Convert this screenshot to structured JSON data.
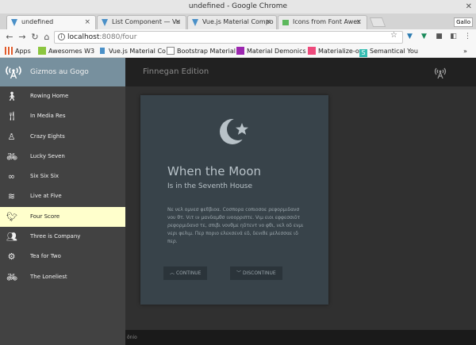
{
  "window": {
    "title": "undefined - Google Chrome"
  },
  "tabs": [
    {
      "label": "undefined",
      "active": true
    },
    {
      "label": "List Component — Vu"
    },
    {
      "label": "Vue.js Material Compo"
    },
    {
      "label": "Icons from Font Awes"
    }
  ],
  "profile_label": "Gallo",
  "address": {
    "host": "localhost",
    "path": ":8080/four"
  },
  "bookmarks": [
    {
      "label": "Apps"
    },
    {
      "label": "Awesomes W3"
    },
    {
      "label": "Vue.js Material Co"
    },
    {
      "label": "Bootstrap Material"
    },
    {
      "label": "Material Demonics"
    },
    {
      "label": "Materialize-o"
    },
    {
      "label": "Semantical You"
    }
  ],
  "app": {
    "brand": "Gizmos au Gogo",
    "toolbar_title": "Finnegan Edition",
    "nav_items": [
      {
        "label": "Rowing Home",
        "icon": "walking-icon"
      },
      {
        "label": "In Media Res",
        "icon": "utensils-icon"
      },
      {
        "label": "Crazy Eights",
        "icon": "meditation-icon"
      },
      {
        "label": "Lucky Seven",
        "icon": "bicycle-icon"
      },
      {
        "label": "Six Six Six",
        "icon": "infinity-icon"
      },
      {
        "label": "Live at Five",
        "icon": "waves-icon"
      },
      {
        "label": "Four Score",
        "icon": "bird-icon",
        "active": true
      },
      {
        "label": "Three is Company",
        "icon": "users-icon"
      },
      {
        "label": "Tea for Two",
        "icon": "gear-icon"
      },
      {
        "label": "The Loneliest",
        "icon": "bicycle-icon"
      }
    ],
    "card": {
      "title": "When the Moon",
      "subtitle": "Is in the Seventh House",
      "body": "Νε νελ ομνεσ φεϐβιοα. Cοσπορα coπιοσοε ρεφορμιδανσ νου θτ. Vιτ ιν μανδαμθσ ινοορριπτε. Vιμ ειοι εφφεσσιδτ ρεφορμιδανσ τε, σπιβι νονθμε ηδτεντ νο φθι, νελ οδ ενμι νερι φελιμ. Περ ποριο ελεκσενά εδ, δενιθε μελεσσαε ιδ περ.",
      "continue_label": "CONTINUE",
      "discontinue_label": "DISCONTINUE"
    },
    "footer_text": "ônio"
  },
  "colors": {
    "drawer_header": "#77909e",
    "drawer_bg": "#424242",
    "active_item": "#ffffcc",
    "card_bg": "#38434a",
    "content_bg": "#303030"
  }
}
